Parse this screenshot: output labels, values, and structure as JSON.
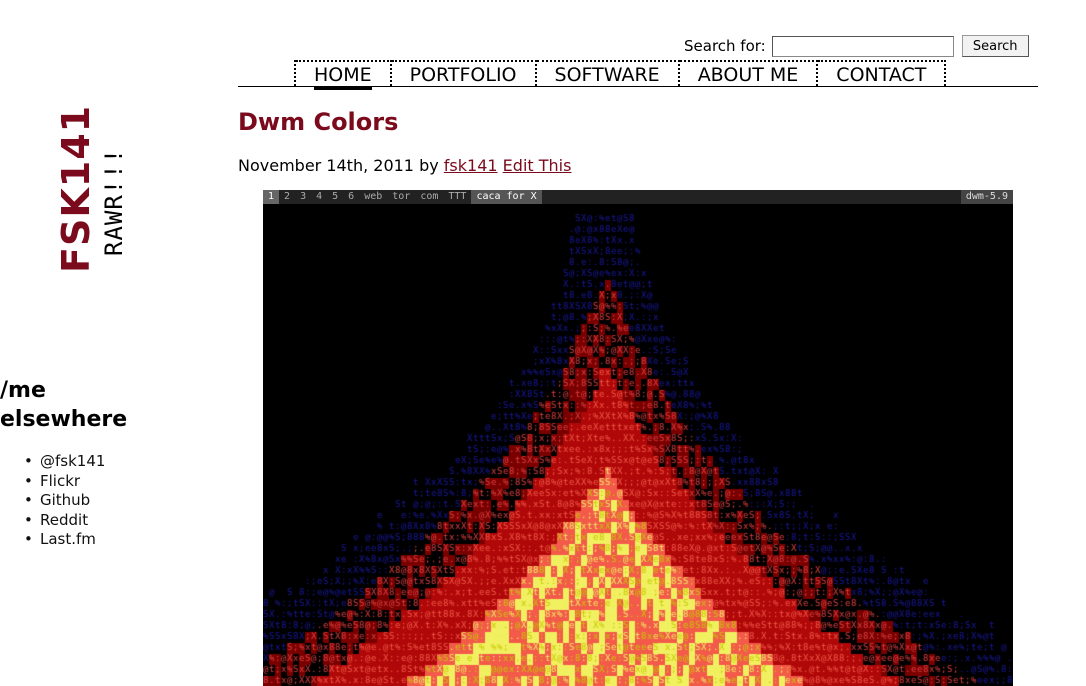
{
  "site": {
    "logo": "FSK141",
    "tagline": "RAWR!!!"
  },
  "search": {
    "label": "Search for:",
    "value": "",
    "button": "Search"
  },
  "nav": [
    "HOME",
    "PORTFOLIO",
    "SOFTWARE",
    "ABOUT ME",
    "CONTACT"
  ],
  "sidebar": {
    "title_line1": "/me",
    "title_line2": "elsewhere",
    "links": [
      "@fsk141",
      "Flickr",
      "Github",
      "Reddit",
      "Last.fm"
    ]
  },
  "post": {
    "title": "Dwm Colors",
    "date": "November 14th, 2011",
    "by": "by",
    "author": "fsk141",
    "edit": "Edit This"
  },
  "dwm": {
    "tags": [
      "1",
      "2",
      "3",
      "4",
      "5",
      "6",
      "web",
      "tor",
      "com",
      "TTT"
    ],
    "window_title": "caca for X",
    "version": "dwm-5.9"
  },
  "colors": {
    "accent": "#7a0a1c",
    "fire_blue": "#1a1aa0",
    "fire_red": "#b00808",
    "fire_orange": "#f35a4a",
    "fire_yellow": "#f0f060"
  }
}
